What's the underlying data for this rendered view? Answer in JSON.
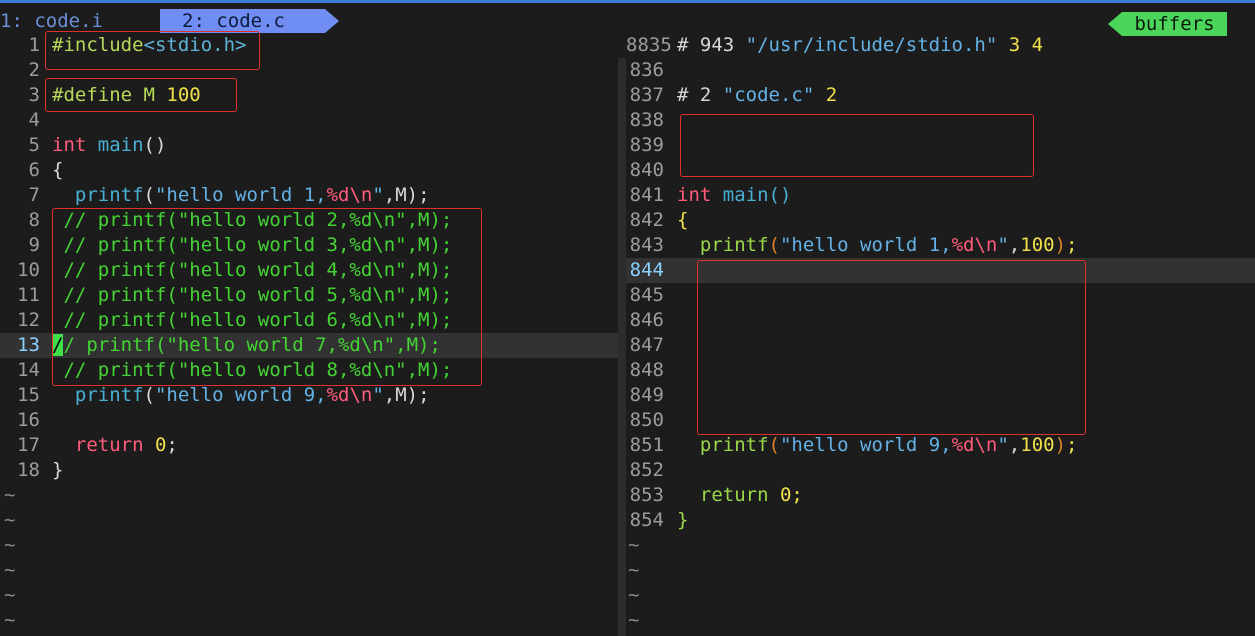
{
  "tabline": {
    "tab1": "1: code.i",
    "tab2": "2: code.c",
    "buffers_label": "buffers"
  },
  "left_pane": {
    "lines": [
      {
        "n": "1",
        "parts": [
          [
            "c-pre",
            "#include"
          ],
          [
            "c-inc",
            "<stdio.h>"
          ]
        ]
      },
      {
        "n": "2",
        "parts": []
      },
      {
        "n": "3",
        "parts": [
          [
            "c-pre",
            "#define M "
          ],
          [
            "c-num",
            "100"
          ]
        ]
      },
      {
        "n": "4",
        "parts": []
      },
      {
        "n": "5",
        "parts": [
          [
            "c-kw",
            "int "
          ],
          [
            "c-fn",
            "main"
          ],
          [
            "c-par",
            "()"
          ]
        ]
      },
      {
        "n": "6",
        "parts": [
          [
            "c-par",
            "{"
          ]
        ]
      },
      {
        "n": "7",
        "parts": [
          [
            "c-par",
            "  "
          ],
          [
            "c-fn",
            "printf"
          ],
          [
            "c-par",
            "("
          ],
          [
            "c-str",
            "\"hello world 1,"
          ],
          [
            "c-fmt",
            "%d\\n"
          ],
          [
            "c-str",
            "\""
          ],
          [
            "c-par",
            ",M);"
          ]
        ]
      },
      {
        "n": "8",
        "parts": [
          [
            "c-cmt",
            " // printf(\"hello world 2,%d\\n\",M);"
          ]
        ]
      },
      {
        "n": "9",
        "parts": [
          [
            "c-cmt",
            " // printf(\"hello world 3,%d\\n\",M);"
          ]
        ]
      },
      {
        "n": "10",
        "parts": [
          [
            "c-cmt",
            " // printf(\"hello world 4,%d\\n\",M);"
          ]
        ]
      },
      {
        "n": "11",
        "parts": [
          [
            "c-cmt",
            " // printf(\"hello world 5,%d\\n\",M);"
          ]
        ]
      },
      {
        "n": "12",
        "parts": [
          [
            "c-cmt",
            " // printf(\"hello world 6,%d\\n\",M);"
          ]
        ]
      },
      {
        "n": "13",
        "parts": [
          [
            "cur",
            "/"
          ],
          [
            "c-cmt",
            "/ printf(\"hello world 7,%d\\n\",M);"
          ]
        ],
        "current": true
      },
      {
        "n": "14",
        "parts": [
          [
            "c-cmt",
            " // printf(\"hello world 8,%d\\n\",M);"
          ]
        ]
      },
      {
        "n": "15",
        "parts": [
          [
            "c-par",
            "  "
          ],
          [
            "c-fn",
            "printf"
          ],
          [
            "c-par",
            "("
          ],
          [
            "c-str",
            "\"hello world 9,"
          ],
          [
            "c-fmt",
            "%d\\n"
          ],
          [
            "c-str",
            "\""
          ],
          [
            "c-par",
            ",M);"
          ]
        ]
      },
      {
        "n": "16",
        "parts": []
      },
      {
        "n": "17",
        "parts": [
          [
            "c-par",
            "  "
          ],
          [
            "c-kw",
            "return "
          ],
          [
            "c-num",
            "0"
          ],
          [
            "c-par",
            ";"
          ]
        ]
      },
      {
        "n": "18",
        "parts": [
          [
            "c-par",
            "}"
          ]
        ]
      }
    ],
    "tilde_count": 6
  },
  "right_pane": {
    "lines": [
      {
        "n": "8835",
        "parts": [
          [
            "c-dir",
            "# 943 "
          ],
          [
            "c-str",
            "\"/usr/include/stdio.h\""
          ],
          [
            "c-yel",
            " 3 4"
          ]
        ]
      },
      {
        "n": "836",
        "parts": []
      },
      {
        "n": "837",
        "parts": [
          [
            "c-dir",
            "# 2 "
          ],
          [
            "c-str",
            "\"code.c\""
          ],
          [
            "c-yel",
            " 2"
          ]
        ]
      },
      {
        "n": "838",
        "parts": []
      },
      {
        "n": "839",
        "parts": []
      },
      {
        "n": "840",
        "parts": []
      },
      {
        "n": "841",
        "parts": [
          [
            "c-kw",
            "int "
          ],
          [
            "c-fn",
            "main"
          ],
          [
            "c-fn",
            "()"
          ]
        ]
      },
      {
        "n": "842",
        "parts": [
          [
            "c-yel",
            "{"
          ]
        ]
      },
      {
        "n": "843",
        "parts": [
          [
            "c-par",
            "  "
          ],
          [
            "c-grn",
            "printf"
          ],
          [
            "c-paro",
            "("
          ],
          [
            "c-str",
            "\"hello world 1,"
          ],
          [
            "c-fmt",
            "%d\\n"
          ],
          [
            "c-str",
            "\""
          ],
          [
            "c-par",
            ","
          ],
          [
            "c-yel",
            "100"
          ],
          [
            "c-paro",
            ")"
          ],
          [
            "c-yel",
            ";"
          ]
        ]
      },
      {
        "n": "844",
        "parts": [],
        "current": true
      },
      {
        "n": "845",
        "parts": []
      },
      {
        "n": "846",
        "parts": []
      },
      {
        "n": "847",
        "parts": []
      },
      {
        "n": "848",
        "parts": []
      },
      {
        "n": "849",
        "parts": []
      },
      {
        "n": "850",
        "parts": []
      },
      {
        "n": "851",
        "parts": [
          [
            "c-par",
            "  "
          ],
          [
            "c-grn",
            "printf"
          ],
          [
            "c-paro",
            "("
          ],
          [
            "c-str",
            "\"hello world 9,"
          ],
          [
            "c-fmt",
            "%d\\n"
          ],
          [
            "c-str",
            "\""
          ],
          [
            "c-par",
            ","
          ],
          [
            "c-yel",
            "100"
          ],
          [
            "c-paro",
            ")"
          ],
          [
            "c-yel",
            ";"
          ]
        ]
      },
      {
        "n": "852",
        "parts": []
      },
      {
        "n": "853",
        "parts": [
          [
            "c-par",
            "  "
          ],
          [
            "c-grn",
            "return "
          ],
          [
            "c-yel",
            "0;"
          ]
        ]
      },
      {
        "n": "854",
        "parts": [
          [
            "c-grn",
            "}"
          ]
        ]
      }
    ],
    "tilde_count": 4
  },
  "tilde_char": "~"
}
